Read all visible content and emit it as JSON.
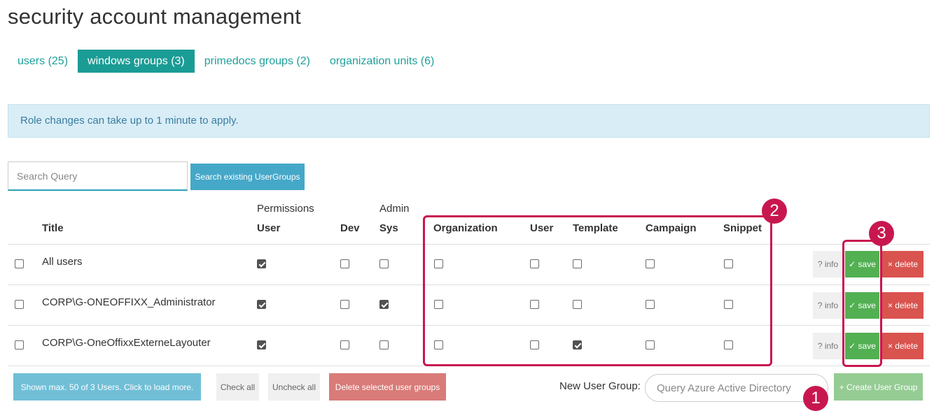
{
  "page": {
    "title": "security account management"
  },
  "tabs": [
    {
      "label": "users (25)"
    },
    {
      "label": "windows groups (3)",
      "active": true
    },
    {
      "label": "primedocs groups (2)"
    },
    {
      "label": "organization units (6)"
    }
  ],
  "alert": {
    "text": "Role changes can take up to 1 minute to apply."
  },
  "search": {
    "placeholder": "Search Query",
    "button_label": "Search existing UserGroups"
  },
  "table": {
    "group_headers": {
      "permissions": "Permissions",
      "admin": "Admin"
    },
    "columns": {
      "title": "Title",
      "user": "User",
      "dev": "Dev",
      "sys": "Sys",
      "organization": "Organization",
      "admin_user": "User",
      "template": "Template",
      "campaign": "Campaign",
      "snippet": "Snippet"
    },
    "rows": [
      {
        "title": "All users",
        "selected": false,
        "user": true,
        "dev": false,
        "sys": false,
        "organization": false,
        "admin_user": false,
        "template": false,
        "campaign": false,
        "snippet": false
      },
      {
        "title": "CORP\\G-ONEOFFIXX_Administrator",
        "selected": false,
        "user": true,
        "dev": false,
        "sys": true,
        "organization": false,
        "admin_user": false,
        "template": false,
        "campaign": false,
        "snippet": false
      },
      {
        "title": "CORP\\G-OneOffixxExterneLayouter",
        "selected": false,
        "user": true,
        "dev": false,
        "sys": false,
        "organization": false,
        "admin_user": false,
        "template": true,
        "campaign": false,
        "snippet": false
      }
    ],
    "row_actions": {
      "info": "? info",
      "save": "✓ save",
      "delete": "× delete"
    }
  },
  "footer": {
    "load_more": "Shown max. 50 of 3 Users. Click to load more.",
    "check_all": "Check all",
    "uncheck_all": "Uncheck all",
    "delete_selected": "Delete selected user groups",
    "new_group_label": "New User Group:",
    "azure_placeholder": "Query Azure Active Directory",
    "create_button": "+ Create User Group"
  },
  "annotations": [
    "1",
    "2",
    "3"
  ],
  "colors": {
    "accent": "#1a9c95",
    "info_bg": "#d9edf6",
    "save": "#52b053",
    "delete": "#d9534f",
    "annotation": "#c8174f"
  }
}
